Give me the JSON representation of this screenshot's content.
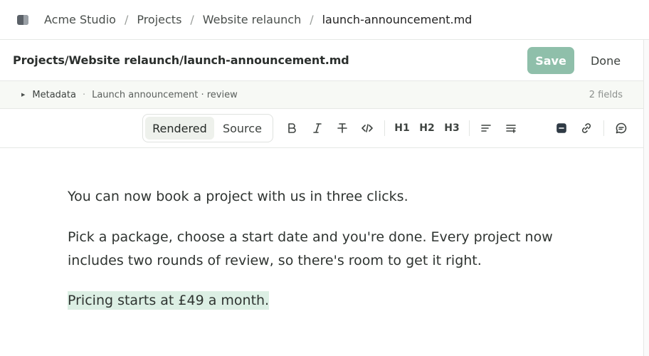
{
  "breadcrumb": {
    "items": [
      "Acme Studio",
      "Projects",
      "Website relaunch"
    ],
    "current": "launch-announcement.md",
    "separator": "/"
  },
  "file": {
    "path": "Projects/Website relaunch/launch-announcement.md",
    "save_label": "Save",
    "done_label": "Done"
  },
  "metadata": {
    "label": "Metadata",
    "summary": "Launch announcement · review",
    "count": "2 fields"
  },
  "toolbar": {
    "view_modes": [
      "Rendered",
      "Source"
    ],
    "selected_mode": "Rendered",
    "headings": [
      "H1",
      "H2",
      "H3"
    ],
    "icons": [
      "bold-icon",
      "italic-icon",
      "strikethrough-icon",
      "code-icon",
      "bullet-list-icon",
      "numbered-list-icon",
      "highlight-icon",
      "link-icon",
      "comment-icon"
    ]
  },
  "document": {
    "paragraphs": [
      "You can now book a project with us in three clicks.",
      "Pick a package, choose a start date and you're done. Every project now includes two rounds of review, so there's room to get it right.",
      "Pricing starts at £49 a month."
    ]
  },
  "colors": {
    "accent": "#8fbfaa",
    "highlight": "#dcefe4",
    "metadata_bg": "#f7f9f5"
  }
}
